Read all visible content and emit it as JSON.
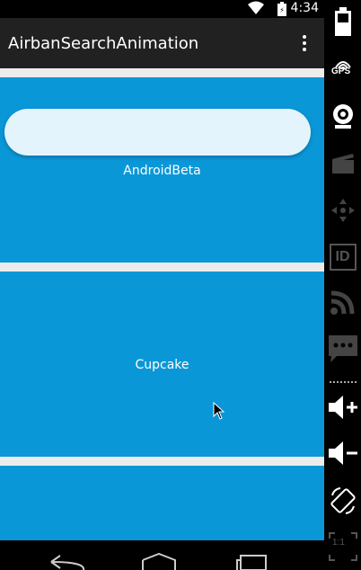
{
  "status_bar": {
    "time": "4:34"
  },
  "app": {
    "title": "AirbanSearchAnimation"
  },
  "search": {
    "value": ""
  },
  "cards": [
    {
      "label": "AndroidBeta"
    },
    {
      "label": "Cupcake"
    },
    {
      "label": ""
    }
  ],
  "emulator_panel": {
    "gps_label": "GPS",
    "id_label": "ID",
    "scale_label": "1:1"
  },
  "colors": {
    "card": "#0a97d8",
    "action_bar": "#212121",
    "search_bar": "#e3f4fc",
    "list_bg": "#ececec"
  },
  "icons": {
    "status": [
      "wifi-icon",
      "battery-icon"
    ],
    "nav": [
      "back-icon",
      "home-icon",
      "recents-icon"
    ],
    "emulator": [
      "battery-icon",
      "gps-icon",
      "camera-icon",
      "video-icon",
      "dpad-icon",
      "id-icon",
      "rss-icon",
      "sms-icon",
      "volume-up-icon",
      "volume-down-icon",
      "rotate-icon",
      "scale-icon"
    ]
  }
}
